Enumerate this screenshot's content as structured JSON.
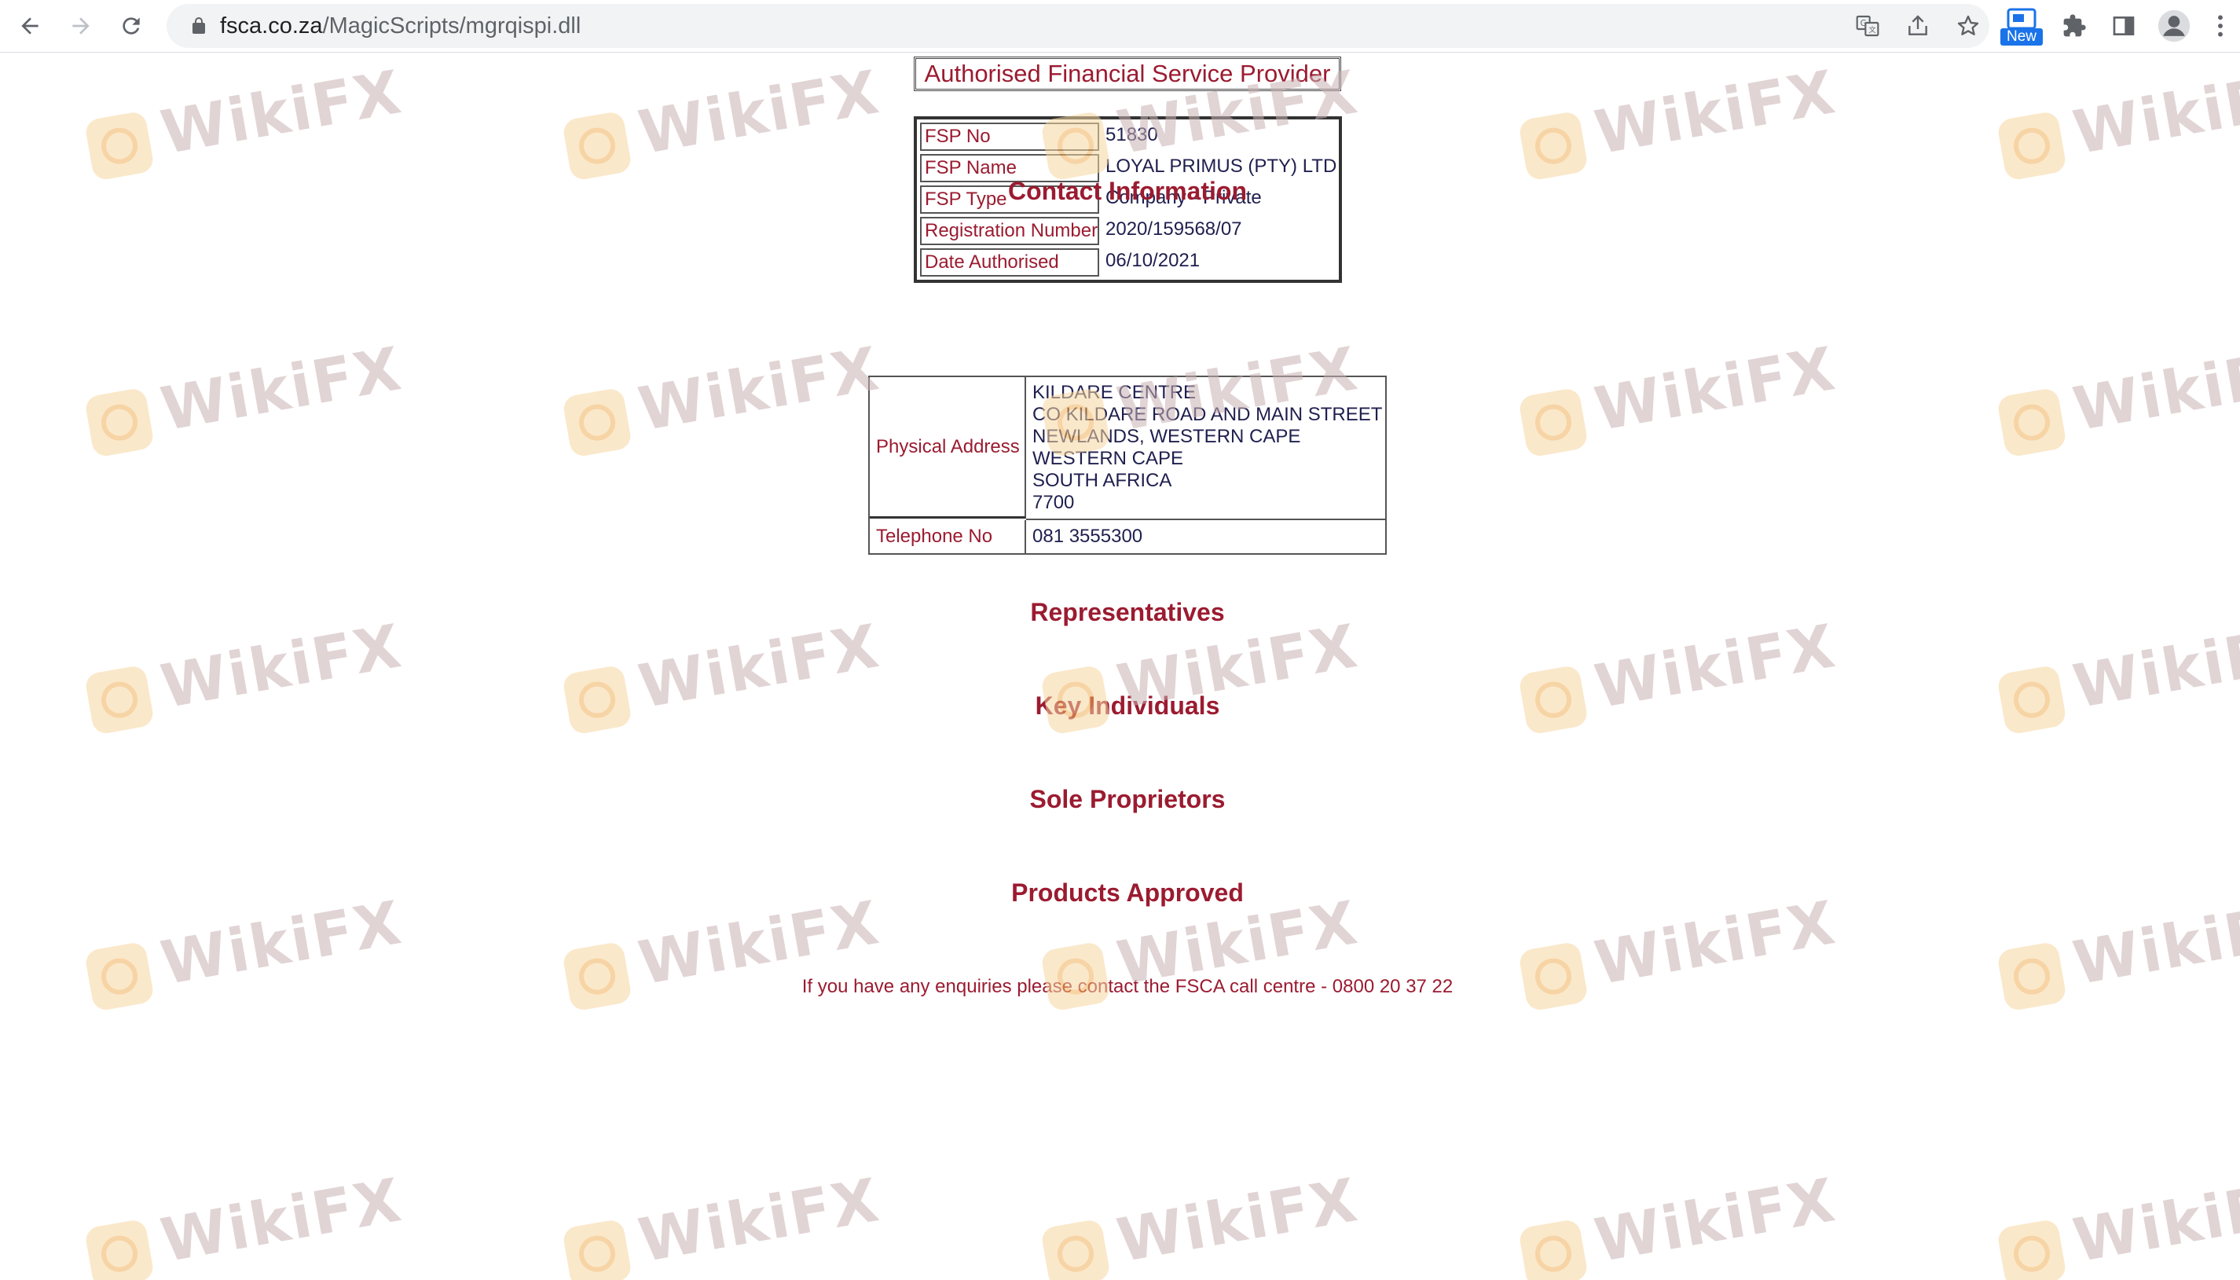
{
  "browser": {
    "url_host": "fsca.co.za",
    "url_path": "/MagicScripts/mgrqispi.dll",
    "new_badge": "New",
    "icons": [
      "back-arrow-icon",
      "forward-arrow-icon",
      "reload-icon",
      "lock-icon",
      "translate-icon",
      "share-icon",
      "star-icon",
      "extensions-puzzle-icon",
      "side-panel-icon",
      "profile-avatar-icon",
      "kebab-menu-icon"
    ]
  },
  "page": {
    "title": "Authorised Financial Service Provider",
    "fsp": [
      {
        "label": "FSP No",
        "value": "51830"
      },
      {
        "label": "FSP Name",
        "value": "LOYAL PRIMUS (PTY) LTD"
      },
      {
        "label": "FSP Type",
        "value": "Company - Private"
      },
      {
        "label": "Registration Number",
        "value": "2020/159568/07"
      },
      {
        "label": "Date Authorised",
        "value": "06/10/2021"
      }
    ],
    "contact_heading": "Contact Information",
    "contact": {
      "address_label": "Physical Address",
      "address_lines": [
        "KILDARE CENTRE",
        "CO KILDARE ROAD AND MAIN STREET",
        "NEWLANDS, WESTERN CAPE",
        "WESTERN CAPE",
        "SOUTH AFRICA",
        "7700"
      ],
      "telephone_label": "Telephone No",
      "telephone_value": "081 3555300"
    },
    "headings": {
      "representatives": "Representatives",
      "key_individuals": "Key Individuals",
      "sole_proprietors": "Sole Proprietors",
      "products_approved": "Products Approved"
    },
    "footer_note": "If you have any enquiries please contact the FSCA call centre - 0800 20 37 22"
  },
  "watermark": {
    "text": "WikiFX"
  },
  "colors": {
    "heading": "#9b1b30",
    "value_text": "#1f1f4f",
    "accent_blue": "#1a73e8"
  }
}
